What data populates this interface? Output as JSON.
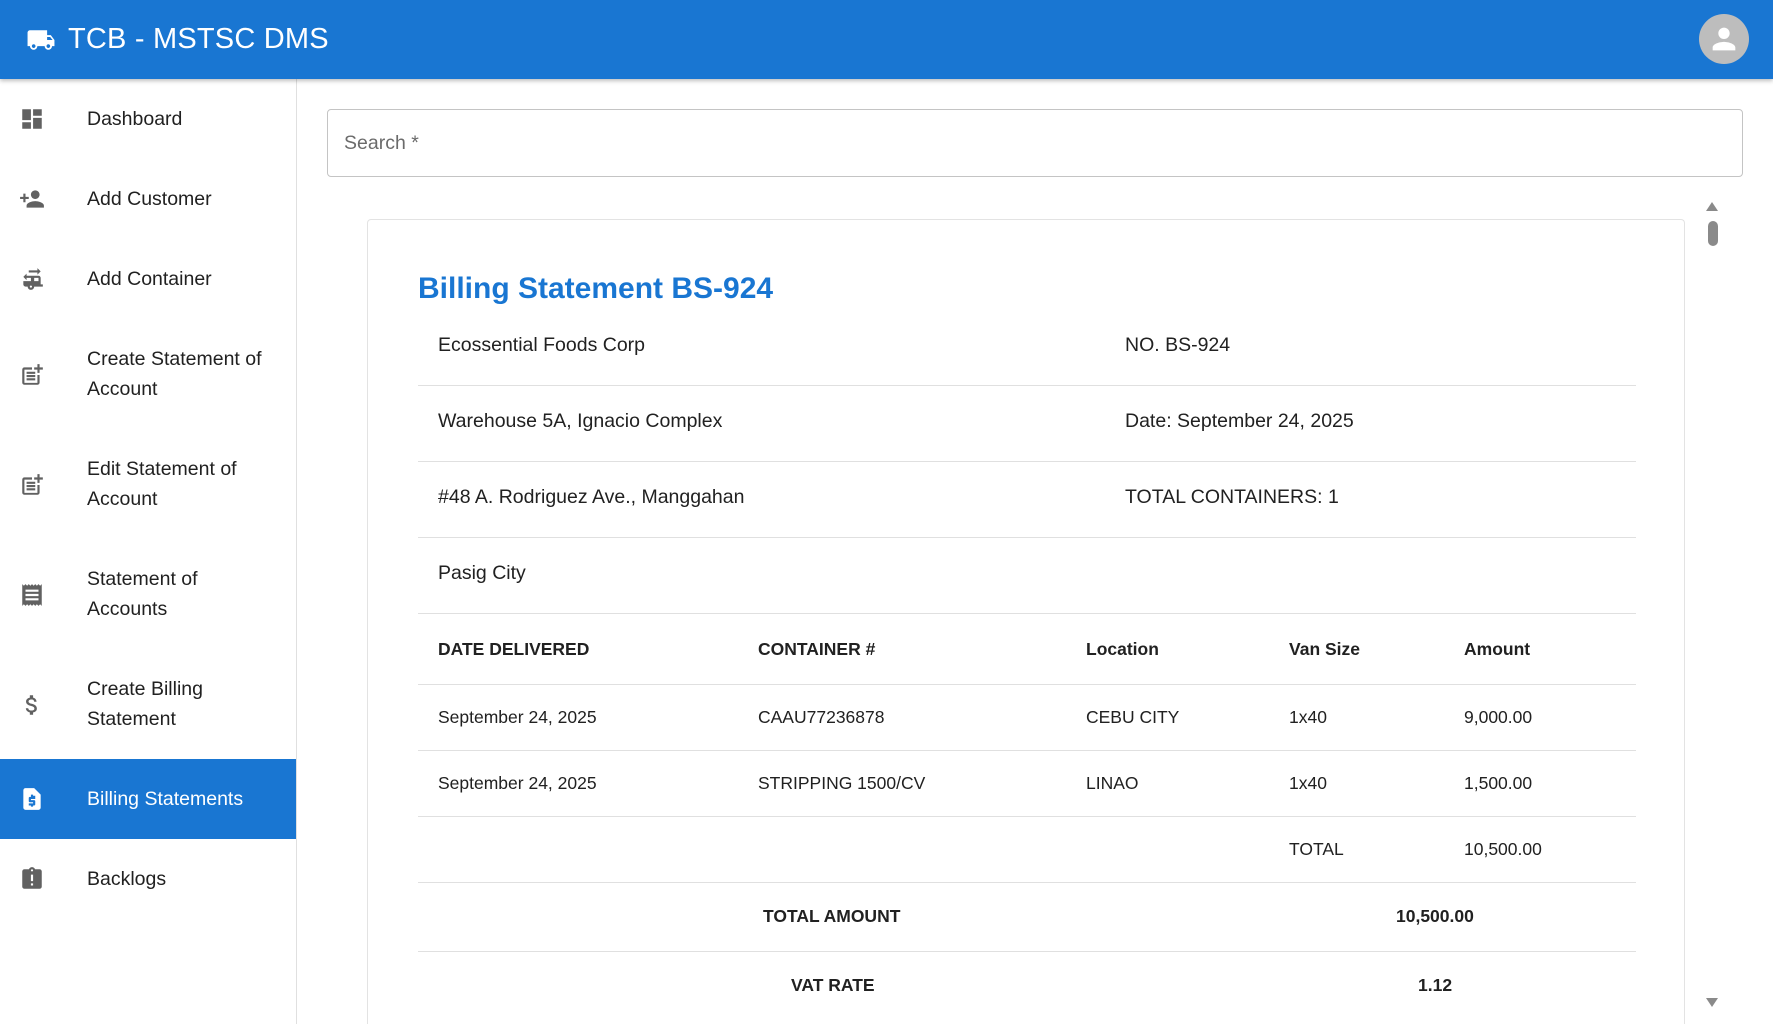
{
  "app": {
    "title": "TCB - MSTSC DMS"
  },
  "sidebar": {
    "items": [
      {
        "label": "Dashboard",
        "icon": "dashboard-icon"
      },
      {
        "label": "Add Customer",
        "icon": "person-add-icon"
      },
      {
        "label": "Add Container",
        "icon": "rv-hookup-icon"
      },
      {
        "label": "Create Statement of Account",
        "icon": "post-add-icon"
      },
      {
        "label": "Edit Statement of Account",
        "icon": "post-add-icon"
      },
      {
        "label": "Statement of Accounts",
        "icon": "receipt-icon"
      },
      {
        "label": "Create Billing Statement",
        "icon": "dollar-icon"
      },
      {
        "label": "Billing Statements",
        "icon": "request-quote-icon",
        "active": true
      },
      {
        "label": "Backlogs",
        "icon": "assignment-late-icon"
      }
    ]
  },
  "search": {
    "placeholder": "Search *",
    "value": ""
  },
  "statement": {
    "title": "Billing Statement BS-924",
    "info": [
      {
        "left": "Ecossential Foods Corp",
        "right": "NO. BS-924"
      },
      {
        "left": "Warehouse 5A, Ignacio Complex",
        "right": "Date: September 24, 2025"
      },
      {
        "left": "#48 A. Rodriguez Ave., Manggahan",
        "right": "TOTAL CONTAINERS: 1"
      },
      {
        "left": "Pasig City",
        "right": ""
      }
    ],
    "table": {
      "headers": [
        "DATE DELIVERED",
        "CONTAINER #",
        "Location",
        "Van Size",
        "Amount"
      ],
      "rows": [
        [
          "September 24, 2025",
          "CAAU77236878",
          "CEBU CITY",
          "1x40",
          "9,000.00"
        ],
        [
          "September 24, 2025",
          "STRIPPING 1500/CV",
          "LINAO",
          "1x40",
          "1,500.00"
        ]
      ],
      "total_label": "TOTAL",
      "total_value": "10,500.00"
    },
    "summary": [
      {
        "label": "TOTAL AMOUNT",
        "value": "10,500.00"
      },
      {
        "label": "VAT RATE",
        "value": "1.12"
      }
    ]
  },
  "colors": {
    "primary": "#1976d2",
    "avatar": "#bdbdbd",
    "icon": "#616161"
  }
}
